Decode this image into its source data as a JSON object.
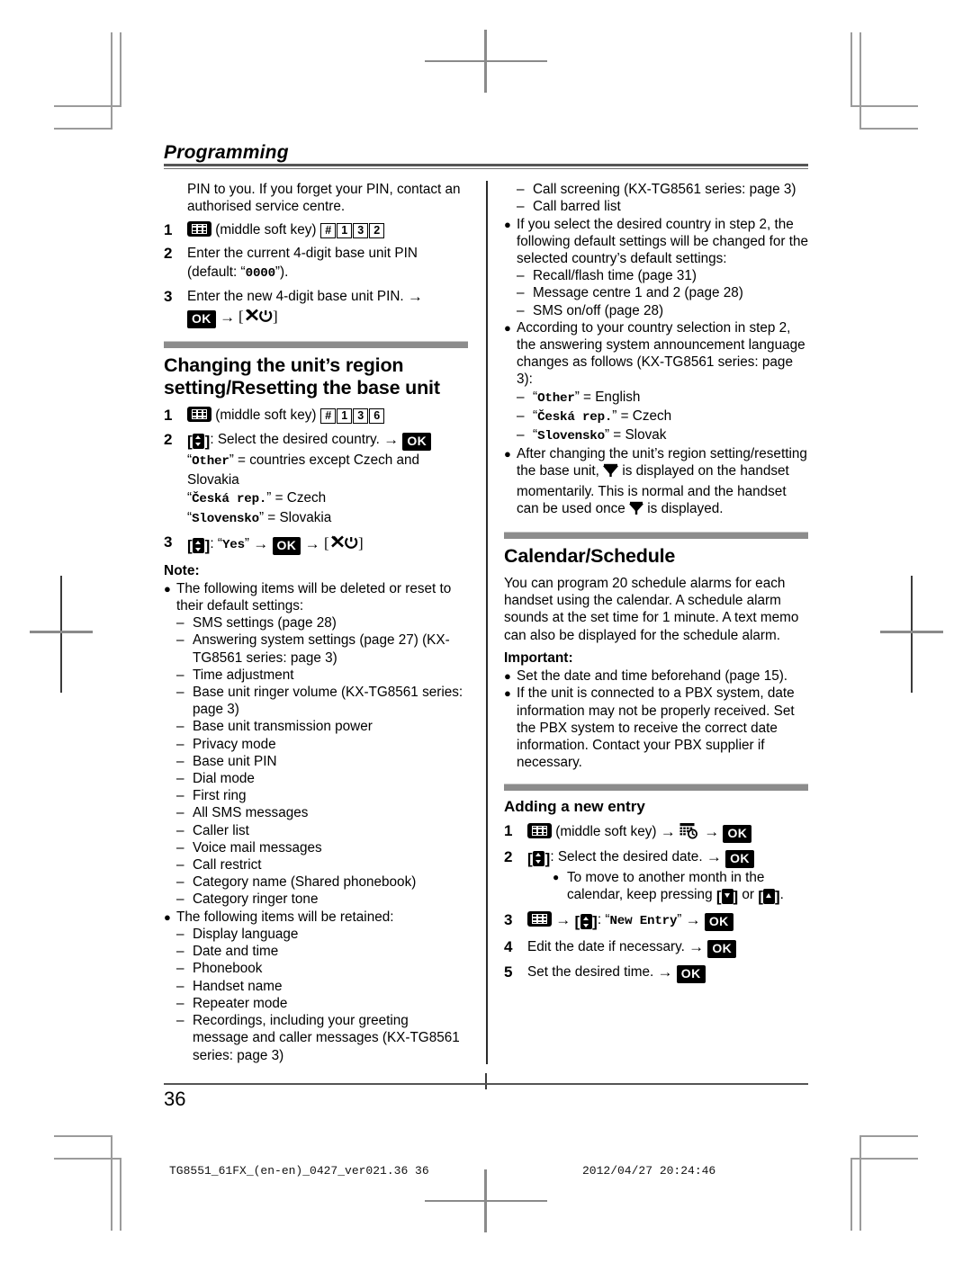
{
  "document": {
    "running_head": "Programming",
    "page_number": "36",
    "footer_left": "TG8551_61FX_(en-en)_0427_ver021.36    36",
    "footer_right": "2012/04/27    20:24:46"
  },
  "left_column": {
    "continued_paragraph": "PIN to you. If you forget your PIN, contact an authorised service centre.",
    "steps_pin": [
      {
        "num": "1",
        "icon": "middle-softkey-icon",
        "label": "(middle soft key)",
        "keys": [
          "#",
          "1",
          "3",
          "2"
        ]
      },
      {
        "num": "2",
        "text_a": "Enter the current 4-digit base unit PIN (default: “",
        "mono": "0000",
        "text_b": "”)."
      },
      {
        "num": "3",
        "text_a": "Enter the new 4-digit base unit PIN.",
        "ok": "OK"
      }
    ],
    "section": {
      "title": "Changing the unit’s region setting/Resetting the base unit",
      "steps": [
        {
          "num": "1",
          "label": "(middle soft key)",
          "keys": [
            "#",
            "1",
            "3",
            "6"
          ]
        },
        {
          "num": "2",
          "text": ": Select the desired country.",
          "ok": "OK",
          "defs": [
            {
              "mono": "Other",
              "plain": " = countries except Czech and Slovakia"
            },
            {
              "mono": "Česká rep.",
              "plain": " = Czech"
            },
            {
              "mono": "Slovensko",
              "plain": " = Slovakia"
            }
          ]
        },
        {
          "num": "3",
          "quote_open": ": “",
          "mono": "Yes",
          "quote_close": "”",
          "ok": "OK"
        }
      ]
    },
    "note": {
      "heading": "Note:",
      "bullets": [
        {
          "text": "The following items will be deleted or reset to their default settings:",
          "sub": [
            "SMS settings (page 28)",
            "Answering system settings (page 27) (KX-TG8561 series: page 3)",
            "Time adjustment",
            "Base unit ringer volume (KX-TG8561 series: page 3)",
            "Base unit transmission power",
            "Privacy mode",
            "Base unit PIN",
            "Dial mode",
            "First ring",
            "All SMS messages",
            "Caller list",
            "Voice mail messages",
            "Call restrict",
            "Category name (Shared phonebook)",
            "Category ringer tone"
          ]
        },
        {
          "text": "The following items will be retained:",
          "sub": [
            "Display language",
            "Date and time",
            "Phonebook",
            "Handset name",
            "Repeater mode",
            "Recordings, including your greeting message and caller messages (KX-TG8561 series: page 3)"
          ]
        }
      ]
    }
  },
  "right_column": {
    "retained_continued": [
      "Call screening (KX-TG8561 series: page 3)",
      "Call barred list"
    ],
    "bullets": [
      {
        "text": "If you select the desired country in step 2, the following default settings will be changed for the selected country’s default settings:",
        "sub": [
          "Recall/flash time (page 31)",
          "Message centre 1 and 2 (page 28)",
          "SMS on/off (page 28)"
        ]
      },
      {
        "text": "According to your country selection in step 2, the answering system announcement language changes as follows (KX-TG8561 series: page 3):",
        "sub_mono": [
          {
            "mono": "Other",
            "plain": " = English"
          },
          {
            "mono": "Česká rep.",
            "plain": " = Czech"
          },
          {
            "mono": "Slovensko",
            "plain": " = Slovak"
          }
        ]
      }
    ],
    "antenna_note": {
      "part1": "After changing the unit’s region setting/resetting the base unit, ",
      "part2": " is displayed on the handset momentarily. This is normal and the handset can be used once ",
      "part3": " is displayed."
    },
    "calendar_section": {
      "title": "Calendar/Schedule",
      "intro": "You can program 20 schedule alarms for each handset using the calendar. A schedule alarm sounds at the set time for 1 minute. A text memo can also be displayed for the schedule alarm.",
      "important_heading": "Important:",
      "important_bullets": [
        "Set the date and time beforehand (page 15).",
        "If the unit is connected to a PBX system, date information may not be properly received. Set the PBX system to receive the correct date information. Contact your PBX supplier if necessary."
      ]
    },
    "adding_entry": {
      "title": "Adding a new entry",
      "steps": [
        {
          "num": "1",
          "label": "(middle soft key)",
          "ok": "OK"
        },
        {
          "num": "2",
          "text": ": Select the desired date.",
          "ok": "OK",
          "note_a": "To move to another month in the calendar, keep pressing ",
          "note_or": " or ",
          "note_b": "."
        },
        {
          "num": "3",
          "quote_open": ": “",
          "mono": "New Entry",
          "quote_close": "”",
          "ok": "OK"
        },
        {
          "num": "4",
          "text": "Edit the date if necessary.",
          "ok": "OK"
        },
        {
          "num": "5",
          "text": "Set the desired time.",
          "ok": "OK"
        }
      ]
    }
  },
  "glyphs": {
    "arrow": "→",
    "bullet": "●",
    "dash": "–",
    "bracket_open": "[",
    "bracket_close": "]"
  }
}
